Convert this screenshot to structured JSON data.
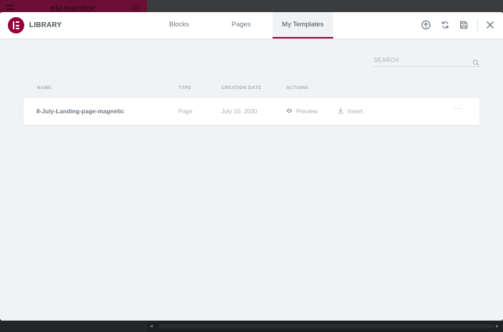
{
  "background": {
    "brand": "elementor"
  },
  "library": {
    "title": "LIBRARY",
    "tabs": [
      {
        "label": "Blocks"
      },
      {
        "label": "Pages"
      },
      {
        "label": "My Templates",
        "active": true
      }
    ],
    "header_icons": [
      "upload-icon",
      "sync-icon",
      "save-icon",
      "close-icon"
    ],
    "search": {
      "placeholder": "SEARCH"
    },
    "columns": {
      "name": "NAME",
      "type": "TYPE",
      "creation_date": "CREATION DATE",
      "actions": "ACTIONS"
    },
    "templates": [
      {
        "name": "8-July-Landing-page-magnetic",
        "type": "Page",
        "creation_date": "July 10, 2020",
        "preview_label": "Preview",
        "insert_label": "Insert",
        "more_label": "···"
      }
    ]
  },
  "colors": {
    "accent": "#93003a",
    "text_dark": "#495157",
    "text_muted": "#a4afb7",
    "modal_bg": "#f1f2f3"
  }
}
